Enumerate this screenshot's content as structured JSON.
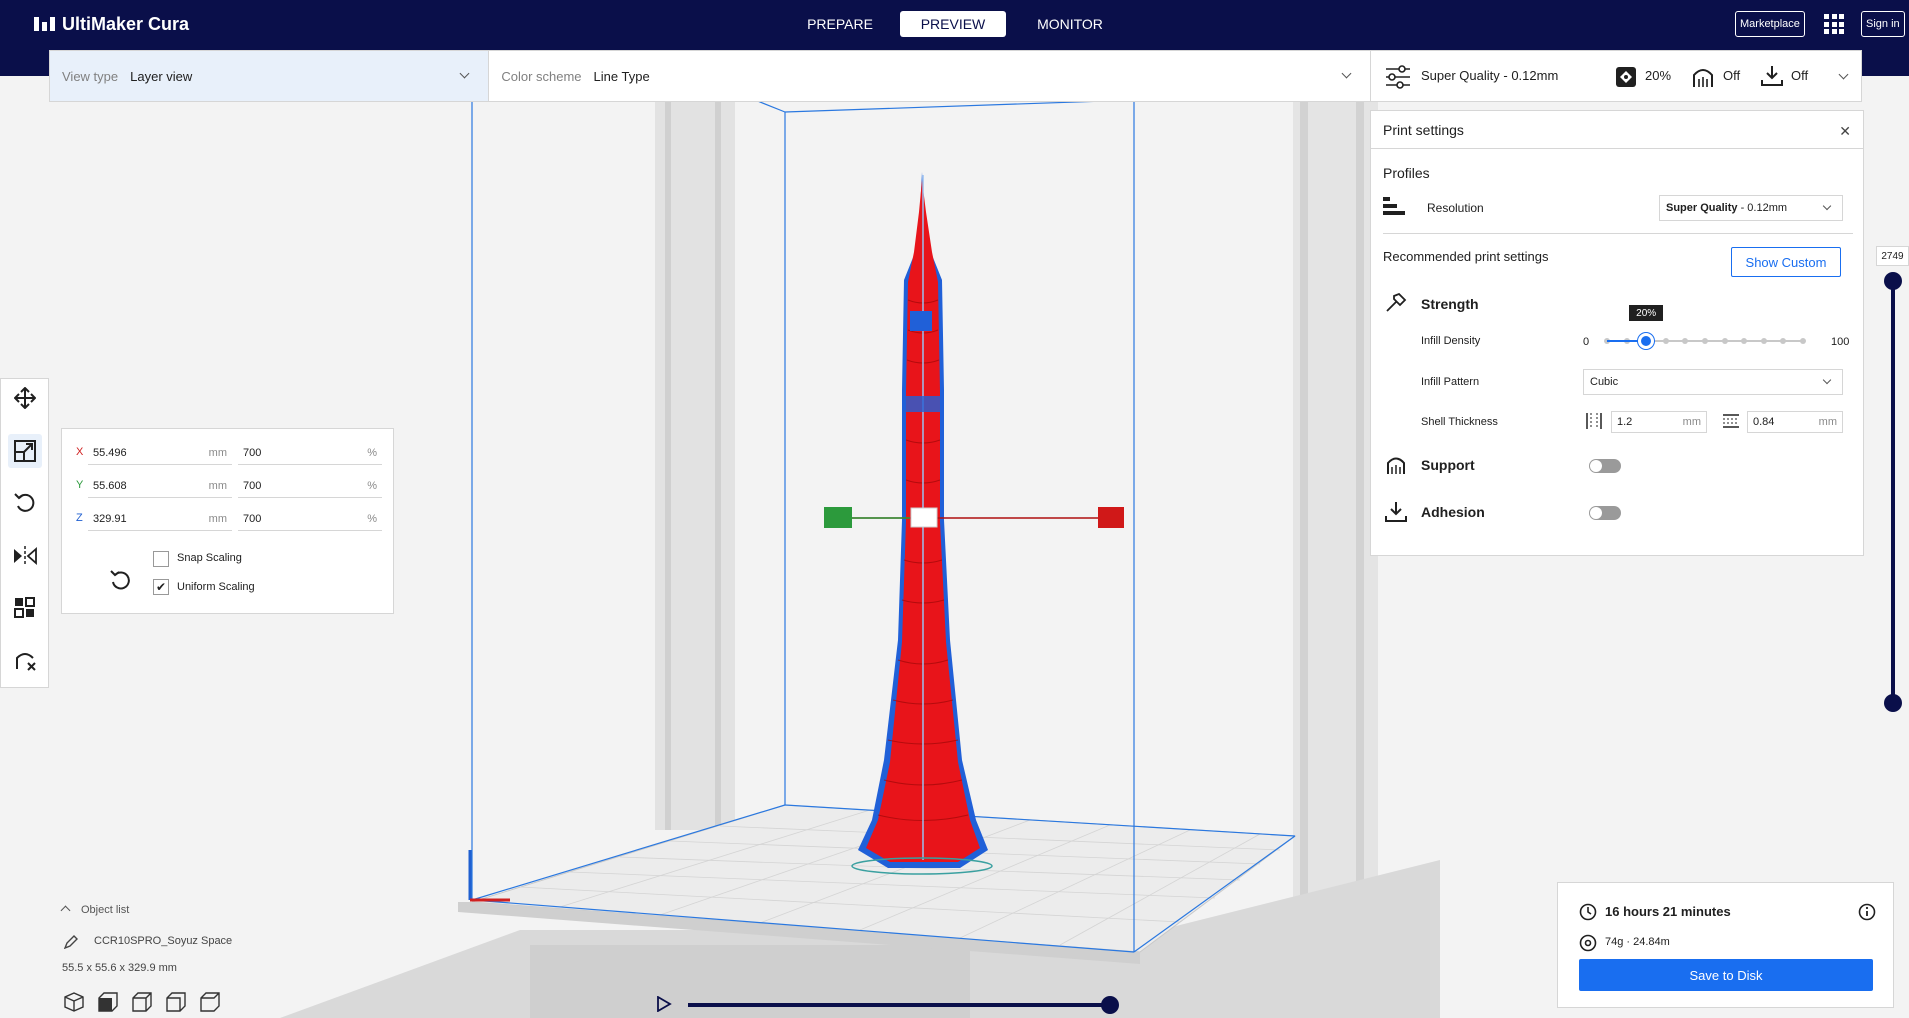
{
  "header": {
    "app_name": "UltiMaker Cura",
    "stages": [
      "PREPARE",
      "PREVIEW",
      "MONITOR"
    ],
    "active_stage": "PREVIEW",
    "marketplace_label": "Marketplace",
    "signin_label": "Sign in"
  },
  "viewbar": {
    "view_type_label": "View type",
    "view_type_value": "Layer view",
    "color_scheme_label": "Color scheme",
    "color_scheme_value": "Line Type"
  },
  "print_setup": {
    "profile": "Super Quality - 0.12mm",
    "infill": "20%",
    "support": "Off",
    "adhesion": "Off"
  },
  "print_settings": {
    "title": "Print settings",
    "profiles_label": "Profiles",
    "resolution_label": "Resolution",
    "resolution_value_bold": "Super Quality",
    "resolution_value_rest": " - 0.12mm",
    "recommended_label": "Recommended print settings",
    "show_custom_label": "Show Custom",
    "strength_label": "Strength",
    "infill_density_label": "Infill Density",
    "infill_min": "0",
    "infill_max": "100",
    "infill_value_tooltip": "20%",
    "infill_fraction": 0.2,
    "infill_pattern_label": "Infill Pattern",
    "infill_pattern_value": "Cubic",
    "shell_thickness_label": "Shell Thickness",
    "wall_thickness": "1.2",
    "top_bottom_thickness": "0.84",
    "unit_mm": "mm",
    "support_label": "Support",
    "adhesion_label": "Adhesion"
  },
  "scale_panel": {
    "rows": [
      {
        "axis": "X",
        "mm": "55.496",
        "percent": "700"
      },
      {
        "axis": "Y",
        "mm": "55.608",
        "percent": "700"
      },
      {
        "axis": "Z",
        "mm": "329.91",
        "percent": "700"
      }
    ],
    "unit_mm": "mm",
    "unit_percent": "%",
    "snap_scaling_label": "Snap Scaling",
    "uniform_scaling_label": "Uniform Scaling",
    "uniform_checked": true
  },
  "object_list": {
    "header": "Object list",
    "object_name": "CCR10SPRO_Soyuz Space",
    "dimensions": "55.5 x 55.6 x 329.9 mm"
  },
  "job_info": {
    "print_time": "16 hours 21 minutes",
    "material": "74g · 24.84m",
    "save_label": "Save to Disk"
  },
  "layer_slider": {
    "value": "2749"
  },
  "colors": {
    "header_bg": "#0a0f4a",
    "accent": "#196ef0",
    "model_red": "#e8141a",
    "model_blue": "#2060d8"
  }
}
